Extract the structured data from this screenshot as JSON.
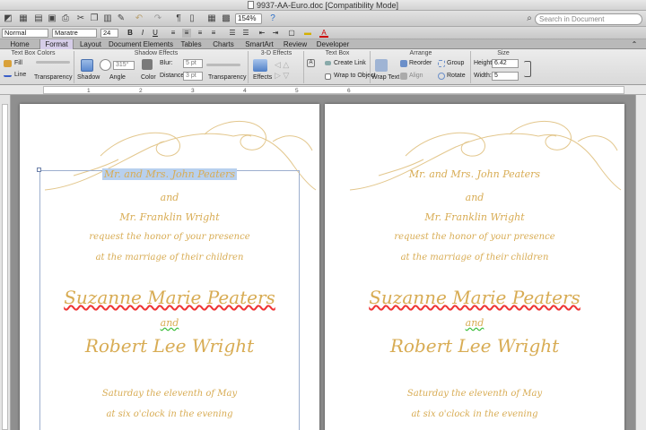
{
  "window": {
    "title": "9937-AA-Euro.doc [Compatibility Mode]"
  },
  "toolbar": {
    "zoom": "154%",
    "search_placeholder": "Search in Document",
    "paragraph_mark": "¶"
  },
  "format": {
    "style": "Normal",
    "font": "Maratre",
    "size": "24",
    "bold": "B",
    "italic": "I",
    "underline": "U",
    "font_color_glyph": "A"
  },
  "tabs": [
    {
      "label": "Home"
    },
    {
      "label": "Format"
    },
    {
      "label": "Layout"
    },
    {
      "label": "Document Elements"
    },
    {
      "label": "Tables"
    },
    {
      "label": "Charts"
    },
    {
      "label": "SmartArt"
    },
    {
      "label": "Review"
    },
    {
      "label": "Developer"
    }
  ],
  "ribbon": {
    "groups": {
      "text_box_colors": "Text Box Colors",
      "shadow_effects": "Shadow Effects",
      "3d_effects": "3-D Effects",
      "text_box": "Text Box",
      "arrange": "Arrange",
      "size": "Size"
    },
    "fill": "Fill",
    "line": "Line",
    "transparency": "Transparency",
    "shadow": "Shadow",
    "angle": "Angle",
    "angle_value": "315°",
    "color": "Color",
    "blur": "Blur:",
    "blur_value": "5 pt",
    "distance": "Distance:",
    "distance_value": "3 pt",
    "transparency2": "Transparency",
    "effects": "Effects",
    "create_link": "Create Link",
    "wrap_to_object": "Wrap to Object",
    "wrap_text": "Wrap Text",
    "reorder": "Reorder",
    "align": "Align",
    "group": "Group",
    "rotate": "Rotate",
    "height_label": "Height:",
    "height_value": "6.42",
    "width_label": "Width:",
    "width_value": "5"
  },
  "ruler": {
    "numbers": [
      "1",
      "2",
      "3",
      "4",
      "5",
      "6"
    ]
  },
  "invitation": {
    "line1": "Mr. and Mrs. John Peaters",
    "line2": "and",
    "line3": "Mr. Franklin Wright",
    "line4": "request the honor of your presence",
    "line5": "at the marriage of their children",
    "bride": "Suzanne Marie Peaters",
    "and2": "and",
    "groom": "Robert Lee Wright",
    "date": "Saturday the eleventh of May",
    "time": "at six o'clock in the evening"
  },
  "colors": {
    "invitation_gold": "#d8ac54",
    "selection": "#b8d0ee",
    "active_tab": "#d6cde8"
  }
}
